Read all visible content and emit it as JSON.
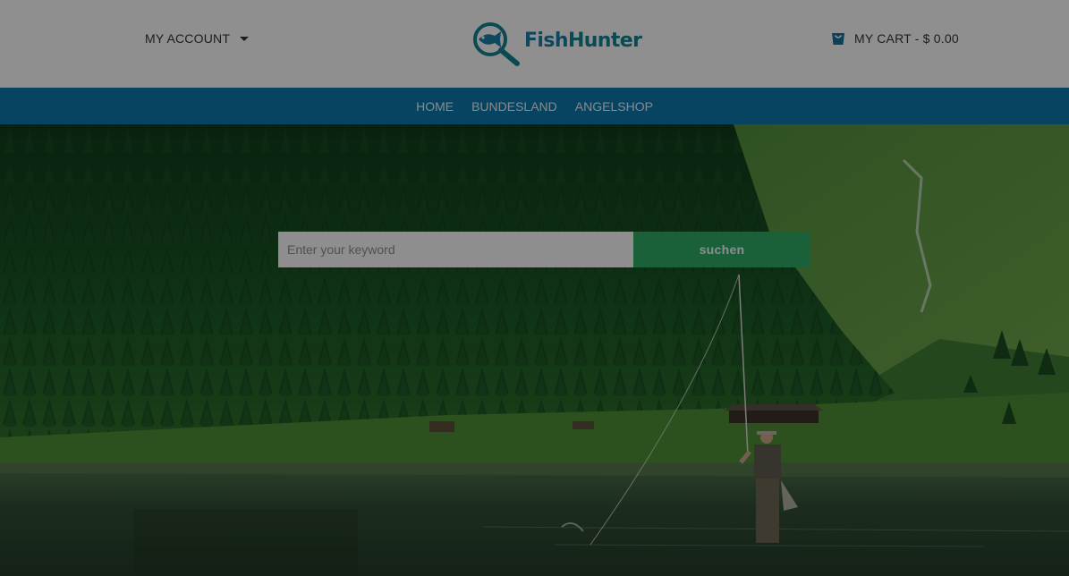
{
  "header": {
    "account_label": "MY ACCOUNT",
    "logo_fish": "Fish",
    "logo_hunter": "Hunter",
    "cart_label": "MY CART - $ 0.00"
  },
  "nav": {
    "items": [
      {
        "label": "HOME"
      },
      {
        "label": "BUNDESLAND"
      },
      {
        "label": "ANGELSHOP"
      }
    ]
  },
  "search": {
    "placeholder": "Enter your keyword",
    "value": "",
    "button_label": "suchen"
  },
  "colors": {
    "nav_background": "#0d76aa",
    "search_button": "#2ea864",
    "logo_fish": "#1a7aa3",
    "logo_hunter": "#12828f",
    "overlay": "rgba(0,0,0,0.42)"
  },
  "icons": {
    "account_menu": "chevron-down-icon",
    "logo": "magnifier-fish-icon",
    "cart": "cart-icon"
  }
}
